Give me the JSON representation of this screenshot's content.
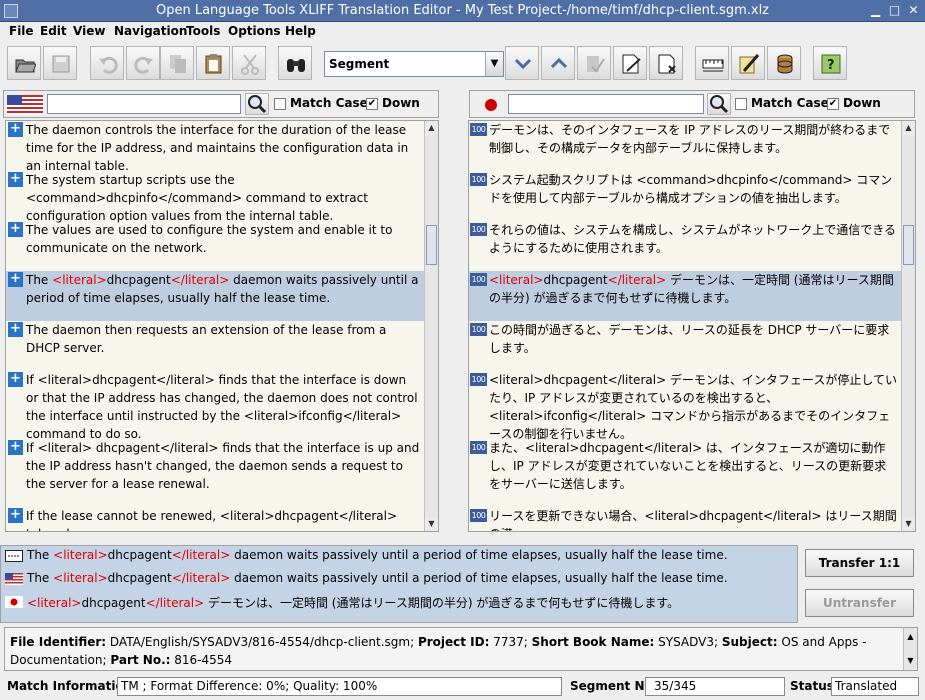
{
  "window": {
    "title": "Open Language Tools XLIFF Translation Editor - My Test Project-/home/timf/dhcp-client.sgm.xlz"
  },
  "menu": [
    "File",
    "Edit",
    "View",
    "Navigation",
    "Tools",
    "Options",
    "Help"
  ],
  "toolbar": {
    "navigation_mode": "Segment"
  },
  "search": {
    "source": {
      "value": "",
      "match_case_label": "Match Case",
      "down_label": "Down",
      "match_case": false,
      "down": true
    },
    "target": {
      "value": "",
      "match_case_label": "Match Case",
      "down_label": "Down",
      "match_case": false,
      "down": true
    }
  },
  "source_segments": [
    {
      "text": "The daemon controls the interface for the duration of the lease time for the IP address, and maintains the configuration data in an internal table."
    },
    {
      "text": "The system startup scripts use the <command>dhcpinfo</command> command to extract configuration option values from the internal table."
    },
    {
      "text": "The values are used to configure the system and enable it to communicate on the network."
    },
    {
      "pre": "The ",
      "tag1": "<literal>",
      "mid": "dhcpagent",
      "tag2": "</literal>",
      "post": " daemon waits passively until a period of time elapses, usually half the lease time."
    },
    {
      "text": "The daemon then requests an extension of the lease from a DHCP server."
    },
    {
      "text": "If <literal>dhcpagent</literal> finds that the interface is down or that the IP address has changed, the daemon does not control the interface until instructed by the <literal>ifconfig</literal> command to do so."
    },
    {
      "text": "If <literal> dhcpagent</literal> finds that the interface is up and the IP address hasn't changed, the daemon sends a request to the server for a lease renewal."
    },
    {
      "text": "If the lease cannot be renewed, <literal>dhcpagent</literal> takes down"
    }
  ],
  "target_segments": [
    {
      "match": "100",
      "text": "デーモンは、そのインタフェースを IP アドレスのリース期間が終わるまで制御し、その構成データを内部テーブルに保持します。"
    },
    {
      "match": "100",
      "text": "システム起動スクリプトは <command>dhcpinfo</command> コマンドを使用して内部テーブルから構成オプションの値を抽出します。"
    },
    {
      "match": "100",
      "text": "それらの値は、システムを構成し、システムがネットワーク上で通信できるようにするために使用されます。"
    },
    {
      "match": "100",
      "tag1": "<literal>",
      "mid": "dhcpagent",
      "tag2": "</literal>",
      "post": " デーモンは、一定時間 (通常はリース期間の半分) が過ぎるまで何もせずに待機します。"
    },
    {
      "match": "100",
      "text": "この時間が過ぎると、デーモンは、リースの延長を DHCP サーバーに要求します。"
    },
    {
      "match": "100",
      "text": "<literal>dhcpagent</literal> デーモンは、インタフェースが停止していたり、IP アドレスが変更されているのを検出すると、<literal>ifconfig</literal> コマンドから指示があるまでそのインタフェースの制御を行いません。"
    },
    {
      "match": "100",
      "text": "また、<literal>dhcpagent</literal> は、インタフェースが適切に動作し、IP アドレスが変更されていないことを検出すると、リースの更新要求をサーバーに送信します。"
    },
    {
      "match": "100",
      "text": "リースを更新できない場合、<literal>dhcpagent</literal> はリース期間の満"
    }
  ],
  "comparison": {
    "tm_source": {
      "pre": "The ",
      "tag1": "<literal>",
      "mid": "dhcpagent",
      "tag2": "</literal>",
      "post": " daemon waits passively until a period of time elapses, usually half the lease time."
    },
    "source": {
      "pre": "The ",
      "tag1": "<literal>",
      "mid": "dhcpagent",
      "tag2": "</literal>",
      "post": " daemon waits passively until a period of time elapses, usually half the lease time."
    },
    "target": {
      "tag1": "<literal>",
      "mid": "dhcpagent",
      "tag2": "</literal>",
      "post": " デーモンは、一定時間 (通常はリース期間の半分) が過ぎるまで何もせずに待機します。"
    }
  },
  "buttons": {
    "transfer": "Transfer 1:1",
    "untransfer": "Untransfer"
  },
  "file_info": {
    "file_identifier_label": "File Identifier:",
    "file_identifier": "DATA/English/SYSADV3/816-4554/dhcp-client.sgm;",
    "project_id_label": "Project ID:",
    "project_id": "7737;",
    "short_book_name_label": "Short Book Name:",
    "short_book_name": "SYSADV3;",
    "subject_label": "Subject:",
    "subject": "OS and Apps - Documentation;",
    "part_no_label": "Part No.:",
    "part_no": "816-4554"
  },
  "status": {
    "match_info_label": "Match Information :",
    "match_info": "TM ; Format Difference: 0%; Quality: 100%",
    "segment_no_label": "Segment No:",
    "segment_no": "35/345",
    "status_label": "Status:",
    "status": "Translated"
  },
  "colors": {
    "title_bar": "#4f6fa6",
    "selected_row": "#bfcde0",
    "pane_bg": "#f7f6ec",
    "tag_red": "#e00000",
    "compare_bg": "#c5d3e6"
  }
}
